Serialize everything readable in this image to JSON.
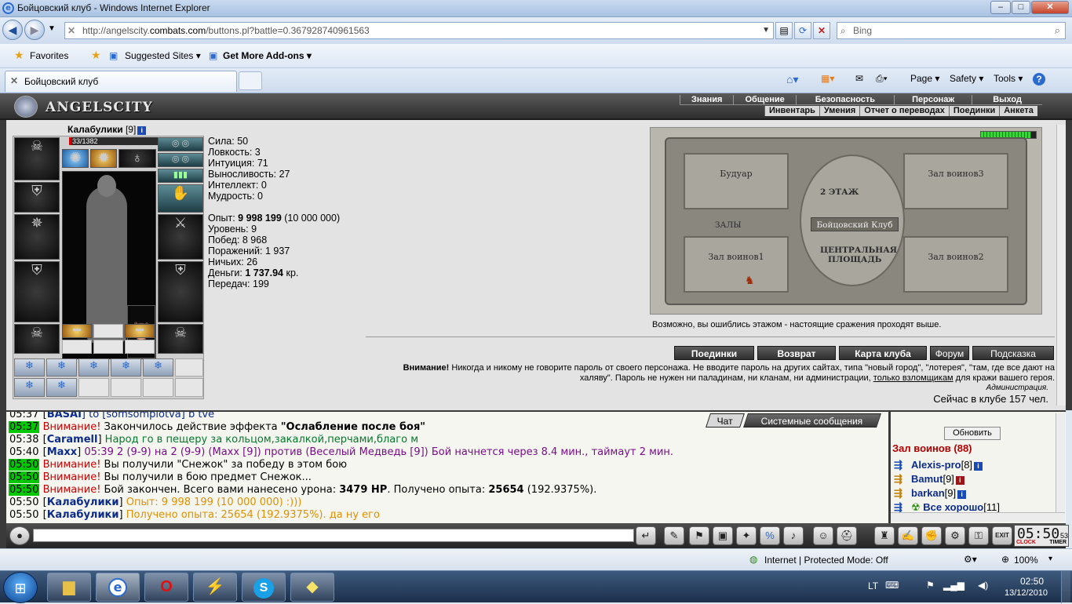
{
  "window": {
    "title": "Бойцовский клуб - Windows Internet Explorer",
    "minimize": "–",
    "maximize": "□",
    "close": "✕"
  },
  "address": {
    "url_prefix": "http://angelscity.",
    "url_domain": "combats.com",
    "url_suffix": "/buttons.pl?battle=0.367928740961563",
    "search_placeholder": "Bing"
  },
  "favorites": {
    "favorites": "Favorites",
    "suggested": "Suggested Sites ▾",
    "addons": "Get More Add-ons ▾"
  },
  "tabs": {
    "active": "Бойцовский клуб",
    "page": "Page ▾",
    "safety": "Safety ▾",
    "tools": "Tools ▾"
  },
  "game": {
    "logo": "ANGELSCITY",
    "menu_top": [
      "Знания",
      "Общение",
      "Безопасность",
      "Персонаж",
      "Выход"
    ],
    "menu_bottom": [
      "Инвентарь",
      "Умения",
      "Отчет о переводах",
      "Поединки",
      "Анкета"
    ]
  },
  "character": {
    "name": "Калабулики",
    "level": "[9]",
    "hp": "33/1382",
    "stats": [
      "Сила: 50",
      "Ловкость: 3",
      "Интуиция: 71",
      "Выносливость: 27",
      "Интеллект: 0",
      "Мудрость: 0"
    ],
    "exp_label": "Опыт: ",
    "exp_value": "9 998 199",
    "exp_next": " (10 000 000)",
    "level_line": "Уровень: 9",
    "wins": "Побед: 8 968",
    "losses": "Поражений: 1 937",
    "draws": "Ничьих: 26",
    "money_label": "Деньги: ",
    "money_value": "1 737.94",
    "money_unit": " кр.",
    "transfers": "Передач: 199"
  },
  "map": {
    "boudoir": "Будуар",
    "hall3": "Зал воинов3",
    "floor": "2 ЭТАЖ",
    "club": "Бойцовский Клуб",
    "halls": "ЗАЛЫ",
    "square1": "ЦЕНТРАЛЬНАЯ",
    "square2": "ПЛОЩАДЬ",
    "hall1": "Зал воинов1",
    "hall2": "Зал воинов2",
    "message": "Возможно, вы ошиблись этажом - настоящие сражения проходят выше."
  },
  "buttons": [
    "Поединки",
    "Возврат",
    "Карта клуба",
    "Форум",
    "Подсказка"
  ],
  "warning": {
    "title": "Внимание!",
    "text1": " Никогда и никому не говорите пароль от своего персонажа. Не вводите пароль на других сайтах, типа \"новый город\", \"лотерея\", \"там, где все дают на халяву\". Пароль не нужен ни паладинам, ни кланам, ни администрации, ",
    "link": "только взломщикам",
    "text2": " для кражи вашего героя.",
    "admin": "Администрация.",
    "online": "Сейчас в клубе 157 чел."
  },
  "chat": {
    "tab_chat": "Чат",
    "tab_system": "Системные сообщения",
    "lines": [
      {
        "time": "05:37",
        "parts": [
          "[",
          "BASAI",
          "] to [somsomplotva] b tve"
        ]
      },
      {
        "time": "05:37",
        "warn": "Внимание!",
        "text": " Закончилось действие эффекта ",
        "bold": "\"Ослабление после боя\""
      },
      {
        "time": "05:38",
        "nick": "Caramell",
        "text": " Народ го в пещеру за кольцом,закалкой,перчами,благо м"
      },
      {
        "time": "05:40",
        "nick": "Maxx",
        "text": " 05:39 2 (9-9) на 2 (9-9) (Maxx [9]) против (Веселый Медведь [9]) Бой начнется через 8.4 мин., таймаут 2 мин."
      },
      {
        "time": "05:50",
        "warn": "Внимание!",
        "text": " Вы получили \"Снежок\" за победу в этом бою"
      },
      {
        "time": "05:50",
        "warn": "Внимание!",
        "text": " Вы получили в бою предмет Снежок..."
      },
      {
        "time": "05:50",
        "warn": "Внимание!",
        "text": " Бой закончен. Всего вами нанесено урона: ",
        "bold": "3479 HP",
        "text2": ". Получено опыта: ",
        "bold2": "25654",
        "text3": " (192.9375%)."
      },
      {
        "time": "05:50",
        "nick": "Калабулики",
        "text": " Опыт: 9 998 199 (10 000 000) :)))"
      },
      {
        "time": "05:50",
        "nick": "Калабулики",
        "text": " Получено опыта: 25654 (192.9375%). да ну его"
      }
    ]
  },
  "userlist": {
    "refresh": "Обновить",
    "hall": "Зал воинов (88)",
    "users": [
      {
        "name": "Alexis-pro",
        "level": "[8]"
      },
      {
        "name": "Bamut",
        "level": "[9]"
      },
      {
        "name": "barkan",
        "level": "[9]"
      },
      {
        "name": "Все хорошо",
        "level": "[11]"
      }
    ]
  },
  "clock": {
    "time": "05:50",
    "sec": "53",
    "l1": "CLOCK",
    "l2": "TIMER"
  },
  "status": {
    "zone": "Internet | Protected Mode: Off",
    "zoom": "100%"
  },
  "tray": {
    "lang": "LT",
    "time": "02:50",
    "date": "13/12/2010"
  }
}
